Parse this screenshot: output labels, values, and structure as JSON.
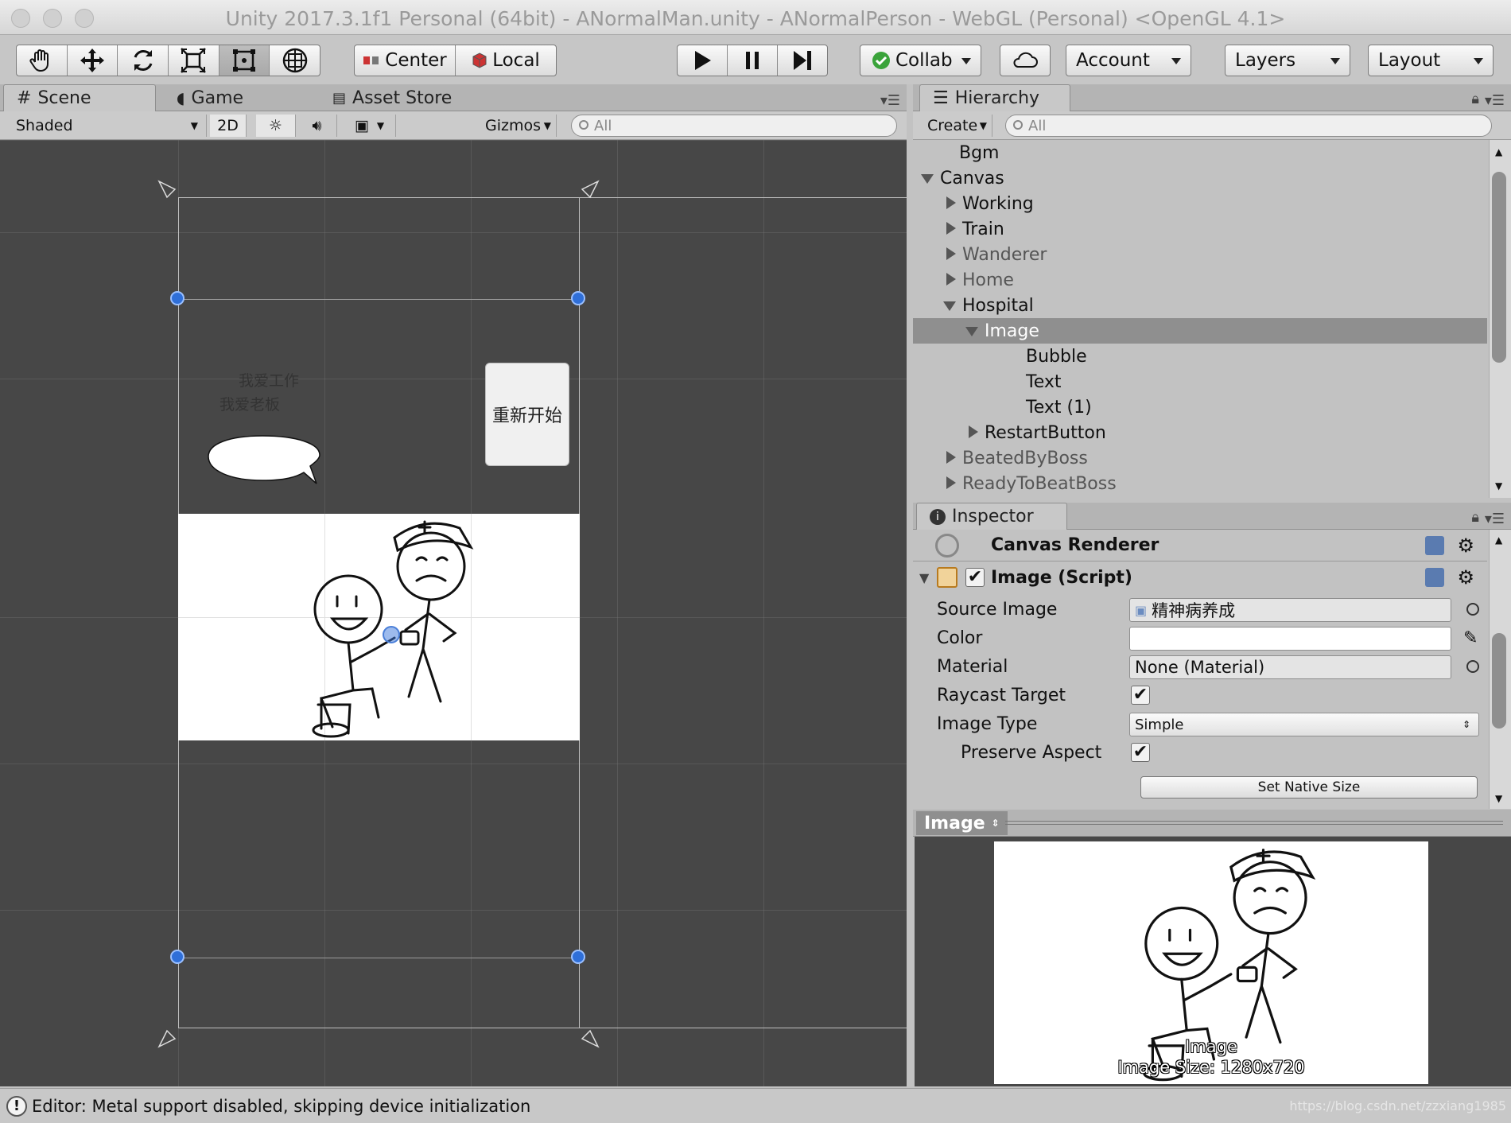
{
  "window": {
    "title": "Unity 2017.3.1f1 Personal (64bit) - ANormalMan.unity - ANormalPerson - WebGL (Personal) <OpenGL 4.1>"
  },
  "toolbar": {
    "tools": [
      "hand-icon",
      "move-icon",
      "rotate-icon",
      "scale-icon",
      "rect-icon",
      "transform-icon"
    ],
    "pivot_label": "Center",
    "space_label": "Local",
    "play_icons": [
      "play-icon",
      "pause-icon",
      "step-icon"
    ],
    "collab_label": "Collab",
    "account_label": "Account",
    "layers_label": "Layers",
    "layout_label": "Layout"
  },
  "scene_panel": {
    "tabs": [
      "Scene",
      "Game",
      "Asset Store"
    ],
    "shading_mode": "Shaded",
    "mode_2d": "2D",
    "gizmos_label": "Gizmos",
    "search_placeholder": "All",
    "canvas_text_1": "我爱工作",
    "canvas_text_2": "我爱老板",
    "restart_button_text": "重新开始"
  },
  "hierarchy": {
    "tab_label": "Hierarchy",
    "create_label": "Create",
    "search_placeholder": "All",
    "items": [
      {
        "label": "Bgm",
        "depth": 0,
        "arrow": "none",
        "dim": false,
        "selected": false
      },
      {
        "label": "Canvas",
        "depth": 0,
        "arrow": "down",
        "dim": false,
        "selected": false
      },
      {
        "label": "Working",
        "depth": 1,
        "arrow": "right",
        "dim": false,
        "selected": false
      },
      {
        "label": "Train",
        "depth": 1,
        "arrow": "right",
        "dim": false,
        "selected": false
      },
      {
        "label": "Wanderer",
        "depth": 1,
        "arrow": "right",
        "dim": true,
        "selected": false
      },
      {
        "label": "Home",
        "depth": 1,
        "arrow": "right",
        "dim": true,
        "selected": false
      },
      {
        "label": "Hospital",
        "depth": 1,
        "arrow": "down",
        "dim": false,
        "selected": false
      },
      {
        "label": "Image",
        "depth": 2,
        "arrow": "down",
        "dim": false,
        "selected": true
      },
      {
        "label": "Bubble",
        "depth": 3,
        "arrow": "none",
        "dim": false,
        "selected": false
      },
      {
        "label": "Text",
        "depth": 3,
        "arrow": "none",
        "dim": false,
        "selected": false
      },
      {
        "label": "Text (1)",
        "depth": 3,
        "arrow": "none",
        "dim": false,
        "selected": false
      },
      {
        "label": "RestartButton",
        "depth": 2,
        "arrow": "right",
        "dim": false,
        "selected": false
      },
      {
        "label": "BeatedByBoss",
        "depth": 1,
        "arrow": "right",
        "dim": true,
        "selected": false
      },
      {
        "label": "ReadyToBeatBoss",
        "depth": 1,
        "arrow": "right",
        "dim": true,
        "selected": false
      }
    ]
  },
  "inspector": {
    "tab_label": "Inspector",
    "canvas_renderer_label": "Canvas Renderer",
    "image_script_label": "Image (Script)",
    "source_image_label": "Source Image",
    "source_image_value": "精神病养成",
    "color_label": "Color",
    "material_label": "Material",
    "material_value": "None (Material)",
    "raycast_label": "Raycast Target",
    "raycast_checked": true,
    "image_type_label": "Image Type",
    "image_type_value": "Simple",
    "preserve_aspect_label": "Preserve Aspect",
    "preserve_aspect_checked": true,
    "set_native_size_label": "Set Native Size"
  },
  "preview": {
    "header_label": "Image",
    "caption_name": "Image",
    "caption_size": "Image Size: 1280x720",
    "watermark": "https://blog.csdn.net/zzxiang1985"
  },
  "status": {
    "message": "Editor: Metal support disabled, skipping device initialization"
  },
  "colors": {
    "scene_bg": "#474747",
    "selection": "#8f8f8f",
    "gizmo_blue": "#2f6fd8"
  }
}
